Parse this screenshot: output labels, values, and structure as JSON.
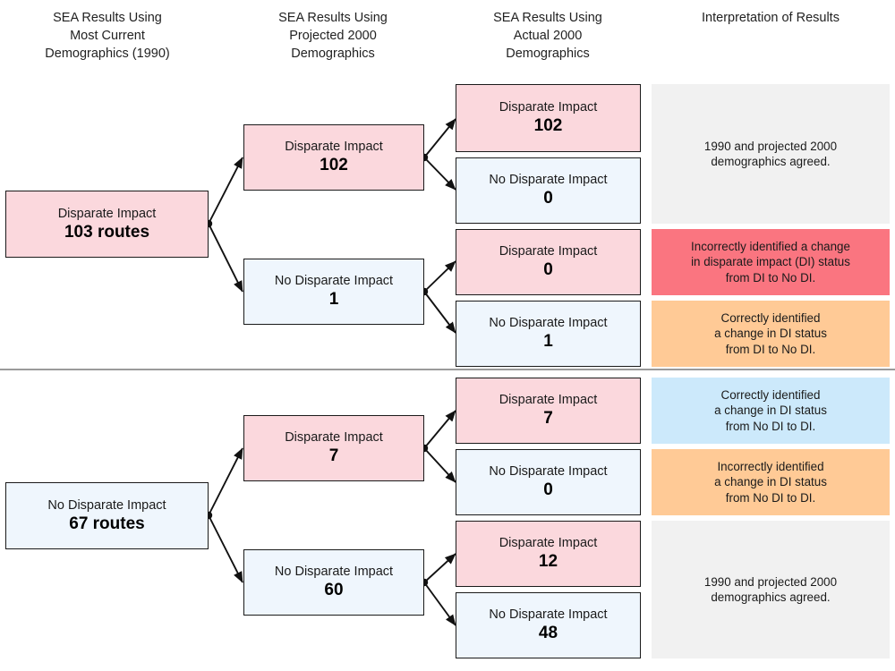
{
  "headers": [
    {
      "text": "SEA Results Using\nMost Current\nDemographics (1990)"
    },
    {
      "text": "SEA Results Using\nProjected 2000\nDemographics"
    },
    {
      "text": "SEA Results Using\nActual 2000\nDemographics"
    },
    {
      "text": "Interpretation of Results"
    }
  ],
  "colors": {
    "pink_fill": "#fbd8dd",
    "blue_fill": "#eff6fd",
    "interp_gray": "#f1f1f1",
    "interp_red": "#fa7580",
    "interp_orange": "#ffca96",
    "interp_blue": "#cce9fb",
    "border": "#1a1a1a",
    "divider": "#9a9a9a"
  },
  "level1": [
    {
      "label": "Disparate Impact",
      "value": "103 routes"
    },
    {
      "label": "No Disparate Impact",
      "value": "67 routes"
    }
  ],
  "level2": [
    {
      "label": "Disparate Impact",
      "value": "102"
    },
    {
      "label": "No Disparate Impact",
      "value": "1"
    },
    {
      "label": "Disparate Impact",
      "value": "7"
    },
    {
      "label": "No Disparate Impact",
      "value": "60"
    }
  ],
  "level3": [
    {
      "label": "Disparate Impact",
      "value": "102"
    },
    {
      "label": "No Disparate Impact",
      "value": "0"
    },
    {
      "label": "Disparate Impact",
      "value": "0"
    },
    {
      "label": "No Disparate Impact",
      "value": "1"
    },
    {
      "label": "Disparate Impact",
      "value": "7"
    },
    {
      "label": "No Disparate Impact",
      "value": "0"
    },
    {
      "label": "Disparate Impact",
      "value": "12"
    },
    {
      "label": "No Disparate Impact",
      "value": "48"
    }
  ],
  "interpretations": [
    {
      "text": "1990 and projected 2000\ndemographics agreed."
    },
    {
      "text": "Incorrectly identified a change\nin disparate impact (DI) status\nfrom DI to No DI."
    },
    {
      "text": "Correctly identified\na change in DI status\nfrom DI to No DI."
    },
    {
      "text": "Correctly identified\na change in DI status\nfrom No DI to DI."
    },
    {
      "text": "Incorrectly identified\na change in DI status\nfrom No DI to DI."
    },
    {
      "text": "1990 and projected 2000\ndemographics agreed."
    }
  ]
}
